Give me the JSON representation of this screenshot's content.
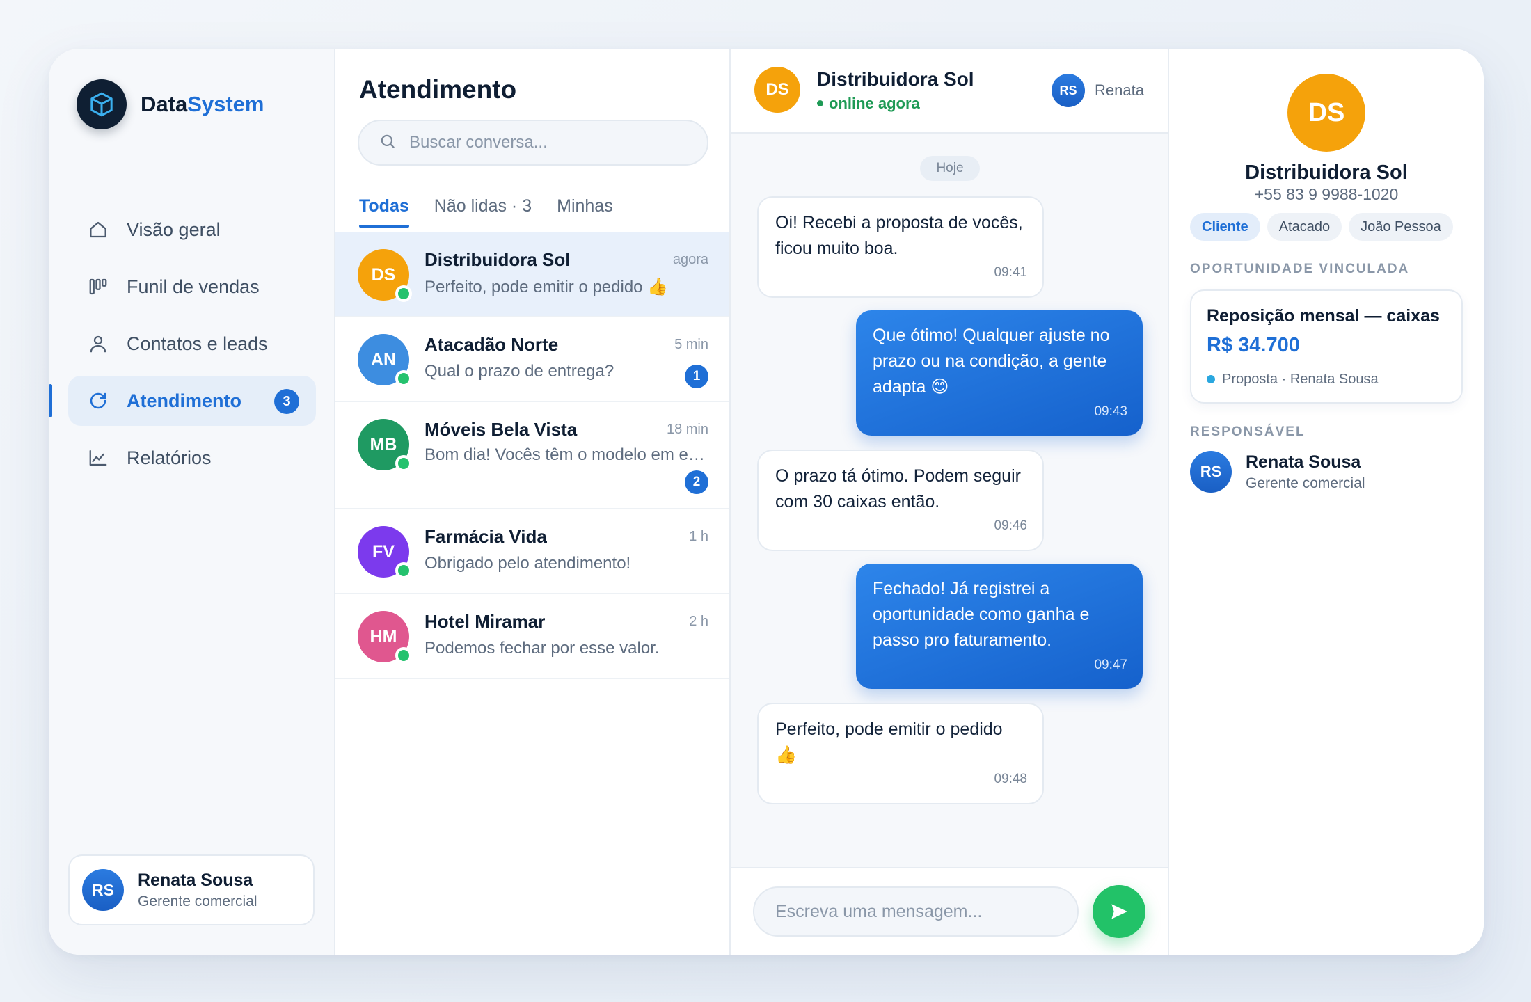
{
  "brand": {
    "name_primary": "Data",
    "name_accent": "System",
    "logo_icon": "cube-icon"
  },
  "nav": {
    "items": [
      {
        "label": "Visão geral",
        "icon": "home-icon"
      },
      {
        "label": "Funil de vendas",
        "icon": "kanban-icon"
      },
      {
        "label": "Contatos e leads",
        "icon": "user-icon"
      },
      {
        "label": "Atendimento",
        "icon": "refresh-chat-icon",
        "active": true,
        "badge": "3"
      },
      {
        "label": "Relatórios",
        "icon": "chart-line-icon"
      }
    ]
  },
  "current_user": {
    "initials": "RS",
    "name": "Renata Sousa",
    "role": "Gerente comercial"
  },
  "conversations_panel": {
    "title": "Atendimento",
    "search_placeholder": "Buscar conversa...",
    "tabs": [
      "Todas",
      "Não lidas · 3",
      "Minhas"
    ],
    "active_tab": 0,
    "items": [
      {
        "initials": "DS",
        "name": "Distribuidora Sol",
        "time": "agora",
        "preview": "Perfeito, pode emitir o pedido 👍",
        "color": "#f5a20b",
        "active": true,
        "badge": ""
      },
      {
        "initials": "AN",
        "name": "Atacadão Norte",
        "time": "5 min",
        "preview": "Qual o prazo de entrega?",
        "color": "#3d8de0",
        "badge": "1"
      },
      {
        "initials": "MB",
        "name": "Móveis Bela Vista",
        "time": "18 min",
        "preview": "Bom dia! Vocês têm o modelo em estoque?",
        "color": "#1f9a62",
        "badge": "2"
      },
      {
        "initials": "FV",
        "name": "Farmácia Vida",
        "time": "1 h",
        "preview": "Obrigado pelo atendimento!",
        "color": "#7c3aed",
        "badge": ""
      },
      {
        "initials": "HM",
        "name": "Hotel Miramar",
        "time": "2 h",
        "preview": "Podemos fechar por esse valor.",
        "color": "#e0578f",
        "badge": ""
      }
    ]
  },
  "chat": {
    "contact_initials": "DS",
    "contact_name": "Distribuidora Sol",
    "status": "online agora",
    "agent_initials": "RS",
    "agent_name": "Renata",
    "date_chip": "Hoje",
    "messages": [
      {
        "direction": "in",
        "text": "Oi! Recebi a proposta de vocês, ficou muito boa.",
        "time": "09:41"
      },
      {
        "direction": "out",
        "text": "Que ótimo! Qualquer ajuste no prazo ou na condição, a gente adapta 😊",
        "time": "09:43"
      },
      {
        "direction": "in",
        "text": "O prazo tá ótimo. Podem seguir com 30 caixas então.",
        "time": "09:46"
      },
      {
        "direction": "out",
        "text": "Fechado! Já registrei a oportunidade como ganha e passo pro faturamento.",
        "time": "09:47"
      },
      {
        "direction": "in",
        "text": "Perfeito, pode emitir o pedido 👍",
        "time": "09:48"
      }
    ],
    "composer_placeholder": "Escreva uma mensagem...",
    "send_icon": "send-icon"
  },
  "details": {
    "initials": "DS",
    "name": "Distribuidora Sol",
    "phone": "+55 83 9 9988-1020",
    "tags": [
      "Cliente",
      "Atacado",
      "João Pessoa"
    ],
    "opportunity_label": "OPORTUNIDADE VINCULADA",
    "opportunity": {
      "title": "Reposição mensal — caixas",
      "value": "R$ 34.700",
      "meta": "Proposta · Renata Sousa"
    },
    "responsible_label": "RESPONSÁVEL",
    "responsible": {
      "initials": "RS",
      "name": "Renata Sousa",
      "role": "Gerente comercial"
    }
  },
  "colors": {
    "accent": "#1f6fd6",
    "online": "#25c26e",
    "send": "#22c268",
    "contact": "#f5a20b"
  }
}
